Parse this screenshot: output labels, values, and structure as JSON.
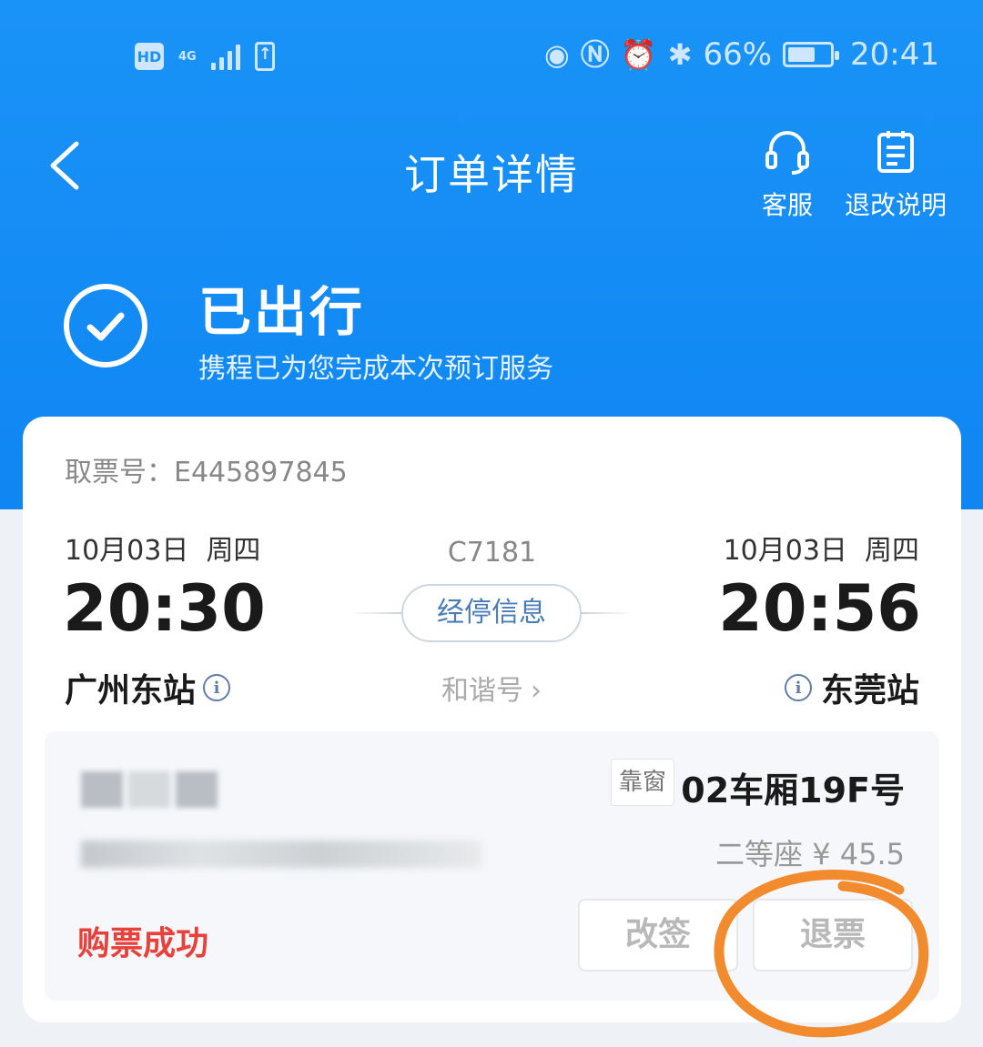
{
  "status_bar": {
    "hd": "HD",
    "network": "4G",
    "battery_percent": "66%",
    "battery_level": 0.66,
    "time": "20:41"
  },
  "nav": {
    "title": "订单详情",
    "service_label": "客服",
    "rules_label": "退改说明"
  },
  "order_status": {
    "title": "已出行",
    "subtitle": "携程已为您完成本次预订服务"
  },
  "ticket": {
    "pickup_label": "取票号：",
    "pickup_number": "E445897845",
    "departure": {
      "date": "10月03日",
      "weekday": "周四",
      "time": "20:30",
      "station": "广州东站"
    },
    "arrival": {
      "date": "10月03日",
      "weekday": "周四",
      "time": "20:56",
      "station": "东莞站"
    },
    "train_number": "C7181",
    "stops_label": "经停信息",
    "train_type": "和谐号",
    "info_glyph": "i",
    "chevron": "›"
  },
  "passenger": {
    "seat_tag": "靠窗",
    "seat": "02车厢19F号",
    "seat_class": "二等座",
    "price": "¥ 45.5",
    "purchase_status": "购票成功",
    "change_label": "改签",
    "refund_label": "退票"
  },
  "colors": {
    "header_blue": "#1a93f8",
    "success_red": "#e8413b",
    "annotation_orange": "#f28a2e",
    "link_blue": "#4a7cb5"
  }
}
